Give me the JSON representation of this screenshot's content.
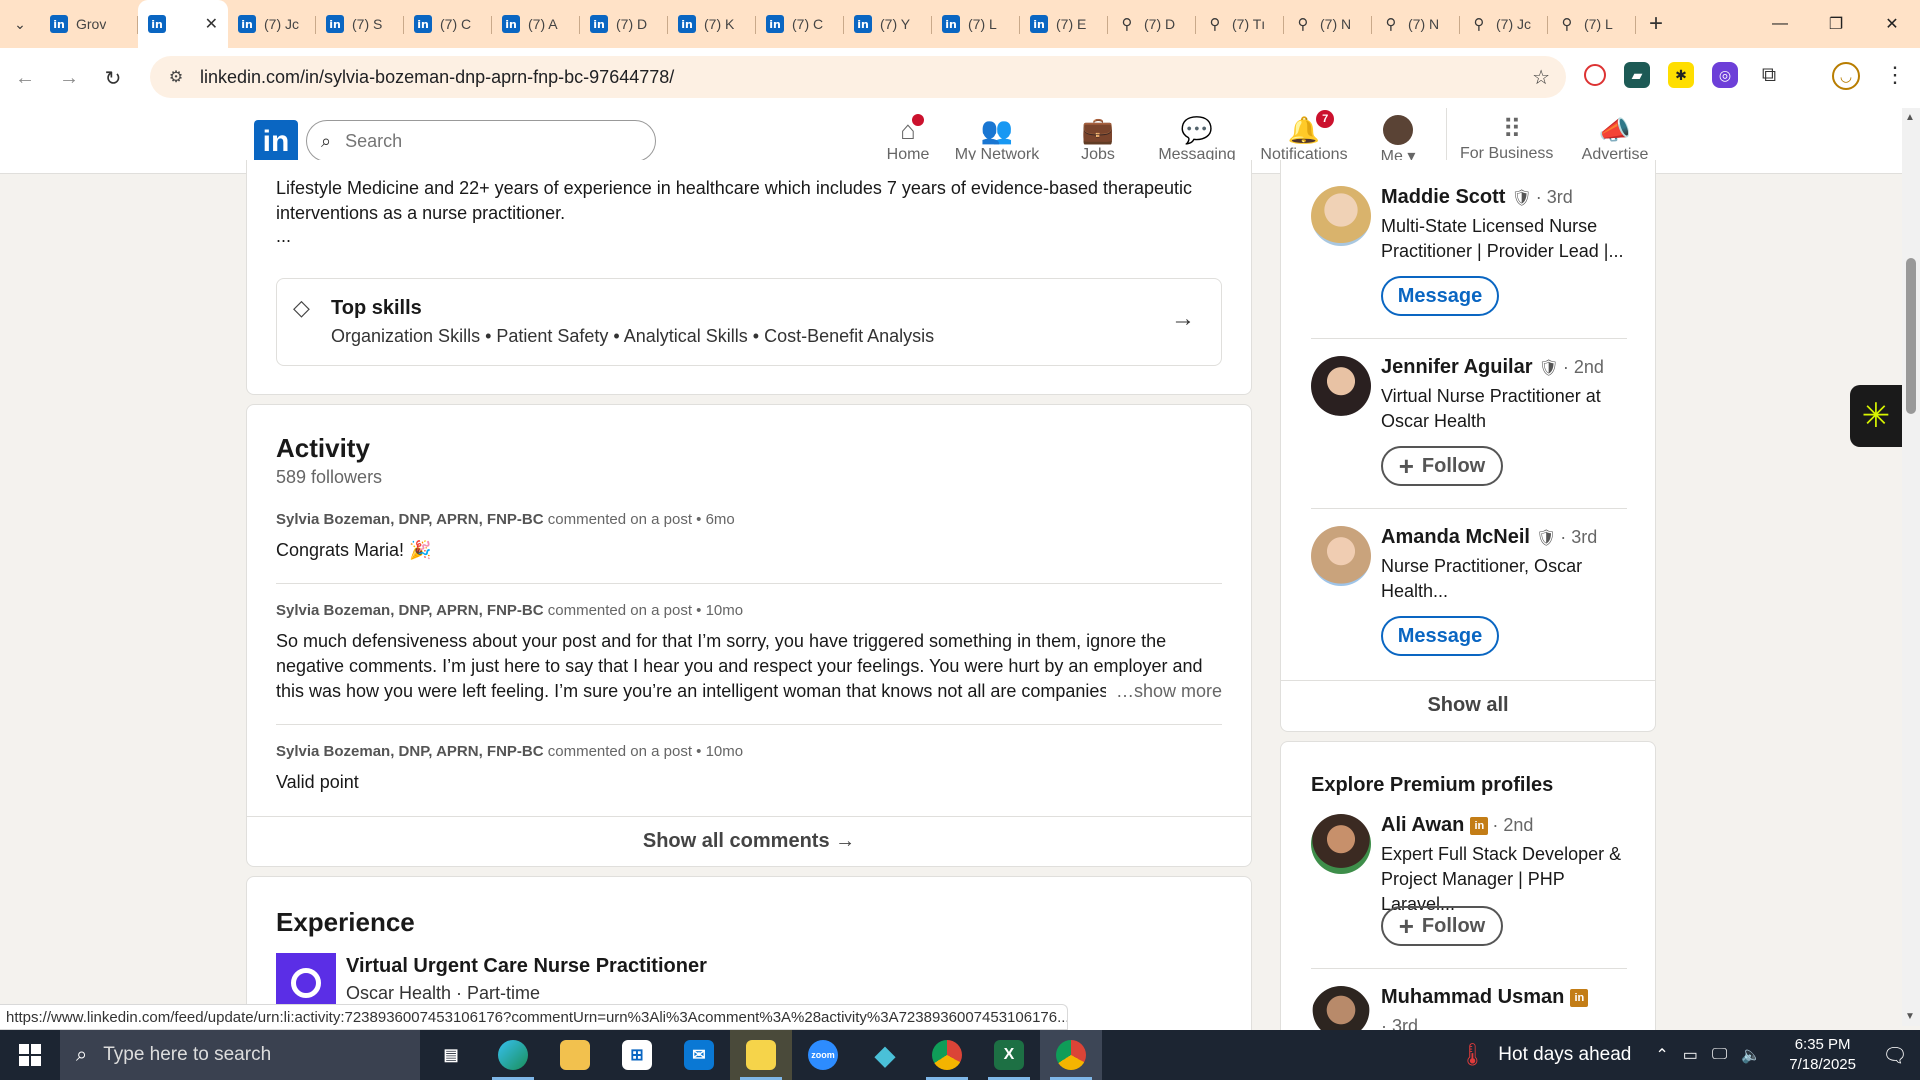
{
  "browser": {
    "tabs": [
      {
        "icon": "in",
        "title": "Grov"
      },
      {
        "icon": "in",
        "title": "",
        "active": true
      },
      {
        "icon": "in",
        "title": "(7) Jc"
      },
      {
        "icon": "in",
        "title": "(7) S"
      },
      {
        "icon": "in",
        "title": "(7) C"
      },
      {
        "icon": "in",
        "title": "(7) A"
      },
      {
        "icon": "in",
        "title": "(7) D"
      },
      {
        "icon": "in",
        "title": "(7) K"
      },
      {
        "icon": "in",
        "title": "(7) C"
      },
      {
        "icon": "in",
        "title": "(7) Y"
      },
      {
        "icon": "in",
        "title": "(7) L"
      },
      {
        "icon": "in",
        "title": "(7) E"
      },
      {
        "icon": "pin",
        "title": "(7) D"
      },
      {
        "icon": "pin",
        "title": "(7) Tı"
      },
      {
        "icon": "pin",
        "title": "(7) N"
      },
      {
        "icon": "pin",
        "title": "(7) N"
      },
      {
        "icon": "pin",
        "title": "(7) Jc"
      },
      {
        "icon": "pin",
        "title": "(7) L"
      }
    ],
    "url": "linkedin.com/in/sylvia-bozeman-dnp-aprn-fnp-bc-97644778/",
    "status_url": "https://www.linkedin.com/feed/update/urn:li:activity:7238936007453106176?commentUrn=urn%3Ali%3Acomment%3A%28activity%3A7238936007453106176..."
  },
  "header": {
    "search_placeholder": "Search",
    "nav": {
      "home": "Home",
      "network": "My Network",
      "jobs": "Jobs",
      "messaging": "Messaging",
      "notifications": "Notifications",
      "notifications_count": "7",
      "me": "Me",
      "business": "For Business",
      "advertise": "Advertise"
    }
  },
  "about": {
    "text": "Lifestyle Medicine and 22+ years of experience in healthcare which includes 7 years of evidence-based therapeutic interventions as a nurse practitioner.",
    "ellipsis": "...",
    "top_skills_title": "Top skills",
    "top_skills": "Organization Skills • Patient Safety • Analytical Skills • Cost-Benefit Analysis"
  },
  "activity": {
    "title": "Activity",
    "followers": "589 followers",
    "items": [
      {
        "author": "Sylvia Bozeman, DNP, APRN, FNP-BC",
        "action": " commented on a post • 6mo",
        "body": "Congrats Maria! 🎉"
      },
      {
        "author": "Sylvia Bozeman, DNP, APRN, FNP-BC",
        "action": " commented on a post • 10mo",
        "body": "So much defensiveness about your post and for that I’m sorry, you have triggered something in them, ignore the negative comments. I’m just here to say that I hear you and respect your feelings. You were hurt by an employer and this was how you were left feeling. I’m sure you’re an intelligent woman that knows not all are companies are like that. You",
        "more": "…show more"
      },
      {
        "author": "Sylvia Bozeman, DNP, APRN, FNP-BC",
        "action": " commented on a post • 10mo",
        "body": "Valid point"
      }
    ],
    "footer": "Show all comments →"
  },
  "experience": {
    "title": "Experience",
    "role": "Virtual Urgent Care Nurse Practitioner",
    "company": "Oscar Health · Part-time"
  },
  "people": {
    "items": [
      {
        "name": "Maddie Scott",
        "degree": "· 3rd",
        "headline": "Multi-State Licensed Nurse Practitioner | Provider Lead |...",
        "action": "Message"
      },
      {
        "name": "Jennifer Aguilar",
        "degree": "· 2nd",
        "headline": "Virtual Nurse Practitioner at Oscar Health",
        "action": "Follow"
      },
      {
        "name": "Amanda McNeil",
        "degree": "· 3rd",
        "headline": "Nurse Practitioner, Oscar Health...",
        "action": "Message"
      }
    ],
    "show_all": "Show all"
  },
  "premium": {
    "title": "Explore Premium profiles",
    "items": [
      {
        "name": "Ali Awan",
        "degree": "· 2nd",
        "headline": "Expert Full Stack Developer & Project Manager | PHP Laravel...",
        "action": "Follow"
      },
      {
        "name": "Muhammad Usman",
        "degree": "· 3rd",
        "headline": "",
        "action": ""
      }
    ]
  },
  "taskbar": {
    "search_placeholder": "Type here to search",
    "weather": "Hot days ahead",
    "time": "6:35 PM",
    "date": "7/18/2025"
  },
  "colors": {
    "linkedin_blue": "#0a66c2",
    "tabstrip": "#ffe2c7",
    "badge_red": "#cb112d"
  }
}
